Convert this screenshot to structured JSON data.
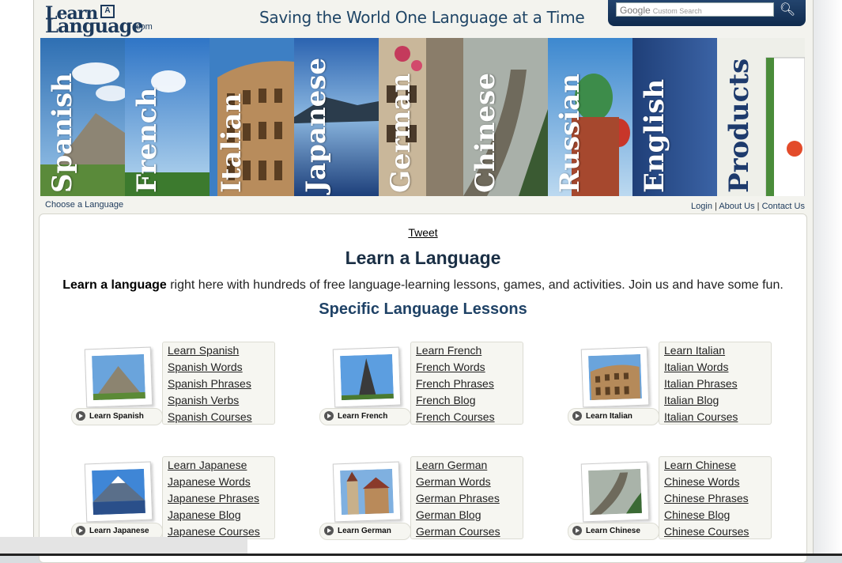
{
  "header": {
    "logo_learn": "Learn",
    "logo_box": "A",
    "logo_language": "Language",
    "logo_com": ".com",
    "tagline": "Saving the World One Language at a Time",
    "search_brand": "Google",
    "search_placeholder": "Custom Search"
  },
  "banner": [
    {
      "label": "Spanish"
    },
    {
      "label": "French"
    },
    {
      "label": "Italian"
    },
    {
      "label": "Japanese"
    },
    {
      "label": "German"
    },
    {
      "label": "Chinese"
    },
    {
      "label": "Russian"
    },
    {
      "label": "English"
    },
    {
      "label": "Products"
    }
  ],
  "subnav": {
    "choose": "Choose a Language",
    "login": "Login",
    "about": "About Us",
    "contact": "Contact Us",
    "sep": "|"
  },
  "content": {
    "tweet": "Tweet",
    "title": "Learn a Language",
    "intro_bold": "Learn a language",
    "intro_rest": " right here with hundreds of free language-learning lessons, games, and activities. Join us and have some fun.",
    "section": "Specific Language Lessons"
  },
  "cards": [
    {
      "button": "Learn Spanish",
      "links": [
        "Learn Spanish",
        "Spanish Words",
        "Spanish Phrases",
        "Spanish Verbs",
        "Spanish Courses"
      ]
    },
    {
      "button": "Learn French",
      "links": [
        "Learn French",
        "French Words",
        "French Phrases",
        "French Blog",
        "French Courses"
      ]
    },
    {
      "button": "Learn Italian",
      "links": [
        "Learn Italian",
        "Italian Words",
        "Italian Phrases",
        "Italian Blog",
        "Italian Courses"
      ]
    },
    {
      "button": "Learn Japanese",
      "links": [
        "Learn Japanese",
        "Japanese Words",
        "Japanese Phrases",
        "Japanese Blog",
        "Japanese Courses"
      ]
    },
    {
      "button": "Learn German",
      "links": [
        "Learn German",
        "German Words",
        "German Phrases",
        "German Blog",
        "German Courses"
      ]
    },
    {
      "button": "Learn Chinese",
      "links": [
        "Learn Chinese",
        "Chinese Words",
        "Chinese Phrases",
        "Chinese Blog",
        "Chinese Courses"
      ]
    }
  ],
  "colors": {
    "brand_navy": "#1d3a5c",
    "heading_blue": "#1f4266"
  }
}
